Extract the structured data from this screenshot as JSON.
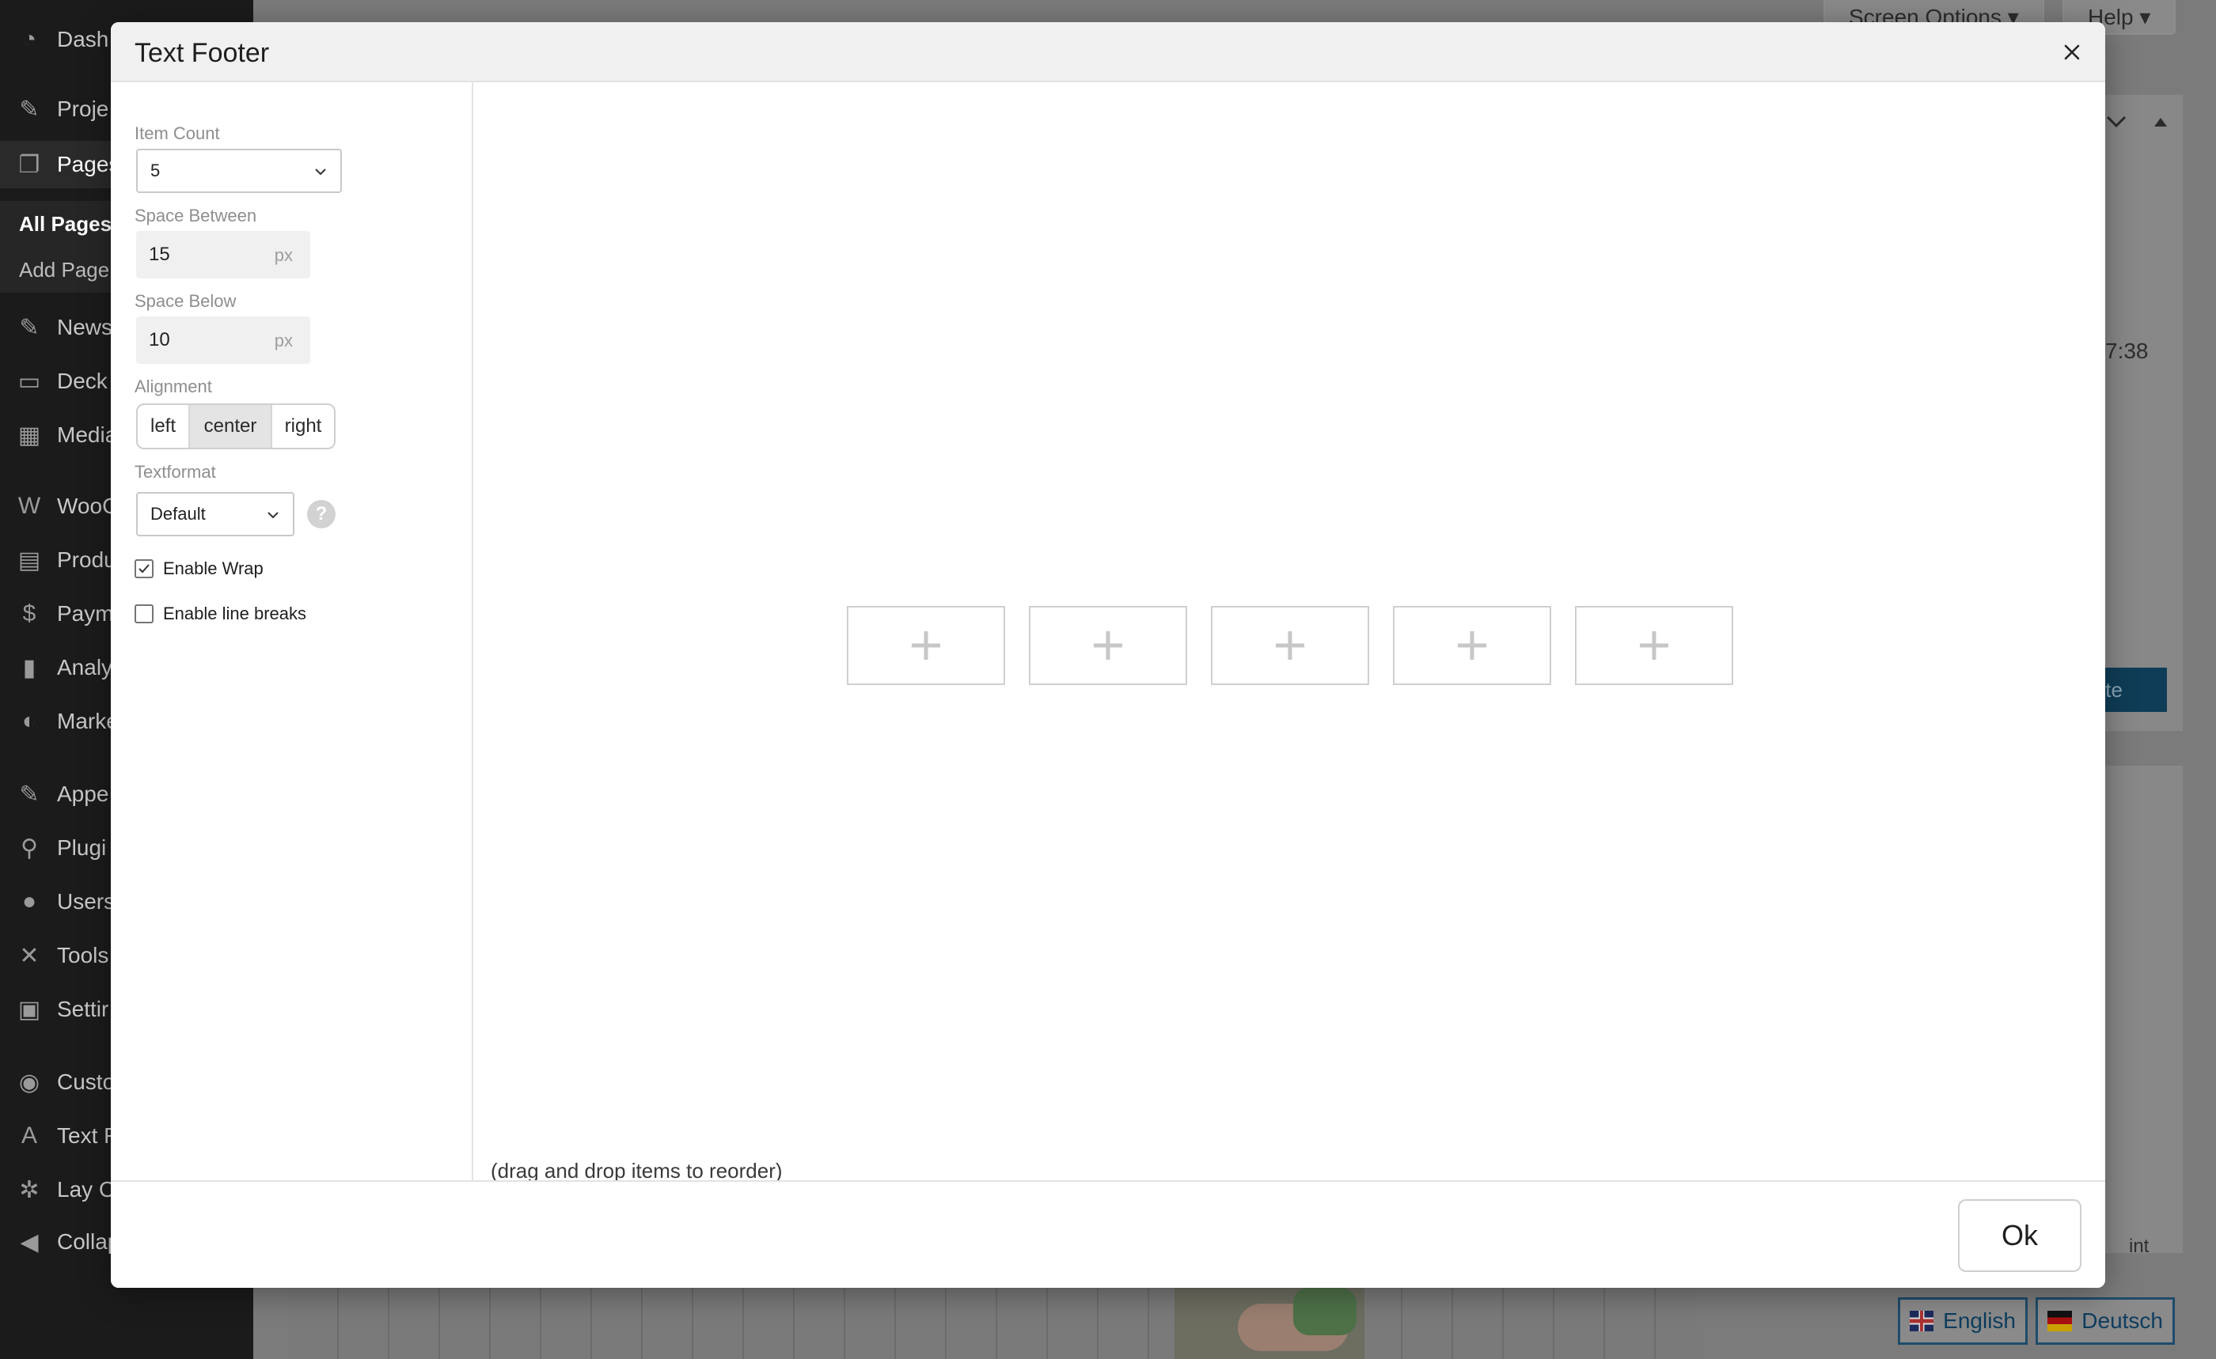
{
  "background": {
    "sidebar_items": [
      {
        "label": "Dash",
        "icon": "dashboard-icon",
        "glyph": "◔"
      },
      {
        "label": "Proje",
        "icon": "pin-icon",
        "glyph": "✎"
      },
      {
        "label": "Pages",
        "icon": "pages-icon",
        "glyph": "❐"
      },
      {
        "label": "News",
        "icon": "news-icon",
        "glyph": "✎"
      },
      {
        "label": "Deck",
        "icon": "deck-icon",
        "glyph": "▭"
      },
      {
        "label": "Media",
        "icon": "media-icon",
        "glyph": "▦"
      },
      {
        "label": "WooC",
        "icon": "woocommerce-icon",
        "glyph": "W"
      },
      {
        "label": "Produ",
        "icon": "products-icon",
        "glyph": "▤"
      },
      {
        "label": "Paym",
        "icon": "payments-icon",
        "glyph": "$"
      },
      {
        "label": "Analy",
        "icon": "analytics-icon",
        "glyph": "▮"
      },
      {
        "label": "Marke",
        "icon": "marketing-icon",
        "glyph": "◐"
      },
      {
        "label": "Appe",
        "icon": "appearance-icon",
        "glyph": "✎"
      },
      {
        "label": "Plugi",
        "icon": "plugins-icon",
        "glyph": "⚲"
      },
      {
        "label": "Users",
        "icon": "users-icon",
        "glyph": "●"
      },
      {
        "label": "Tools",
        "icon": "tools-icon",
        "glyph": "✕"
      },
      {
        "label": "Settir",
        "icon": "settings-icon",
        "glyph": "▣"
      },
      {
        "label": "Custo",
        "icon": "eye-icon",
        "glyph": "◉"
      },
      {
        "label": "Text F",
        "icon": "text-icon",
        "glyph": "A"
      },
      {
        "label": "Lay C",
        "icon": "gear-icon",
        "glyph": "✲"
      },
      {
        "label": "Collap",
        "icon": "collapse-icon",
        "glyph": "◀"
      }
    ],
    "pages_submenu": [
      "All Pages",
      "Add Page"
    ],
    "screen_options": "Screen Options ▾",
    "help": "Help ▾",
    "time_fragment": "7:38",
    "update_fragment": "late",
    "int_fragment": "int",
    "languages": [
      {
        "label": "English",
        "flag": "uk"
      },
      {
        "label": "Deutsch",
        "flag": "de"
      }
    ]
  },
  "modal": {
    "title": "Text Footer",
    "item_count": {
      "label": "Item Count",
      "value": "5"
    },
    "space_between": {
      "label": "Space Between",
      "value": "15",
      "unit": "px"
    },
    "space_below": {
      "label": "Space Below",
      "value": "10",
      "unit": "px"
    },
    "alignment": {
      "label": "Alignment",
      "options": [
        "left",
        "center",
        "right"
      ],
      "selected": "center"
    },
    "textformat": {
      "label": "Textformat",
      "value": "Default"
    },
    "enable_wrap": {
      "label": "Enable Wrap",
      "checked": true
    },
    "enable_line_breaks": {
      "label": "Enable line breaks",
      "checked": false
    },
    "slots": [
      "add-item-slot-1",
      "add-item-slot-2",
      "add-item-slot-3",
      "add-item-slot-4",
      "add-item-slot-5"
    ],
    "hint": "(drag and drop items to reorder)",
    "ok_label": "Ok"
  },
  "colors": {
    "overlay_dim": "#5b5b5b",
    "modal_header_bg": "#f0f0f0",
    "accent_blue": "#0e3d5e",
    "border_gray": "#cfcfcf"
  }
}
